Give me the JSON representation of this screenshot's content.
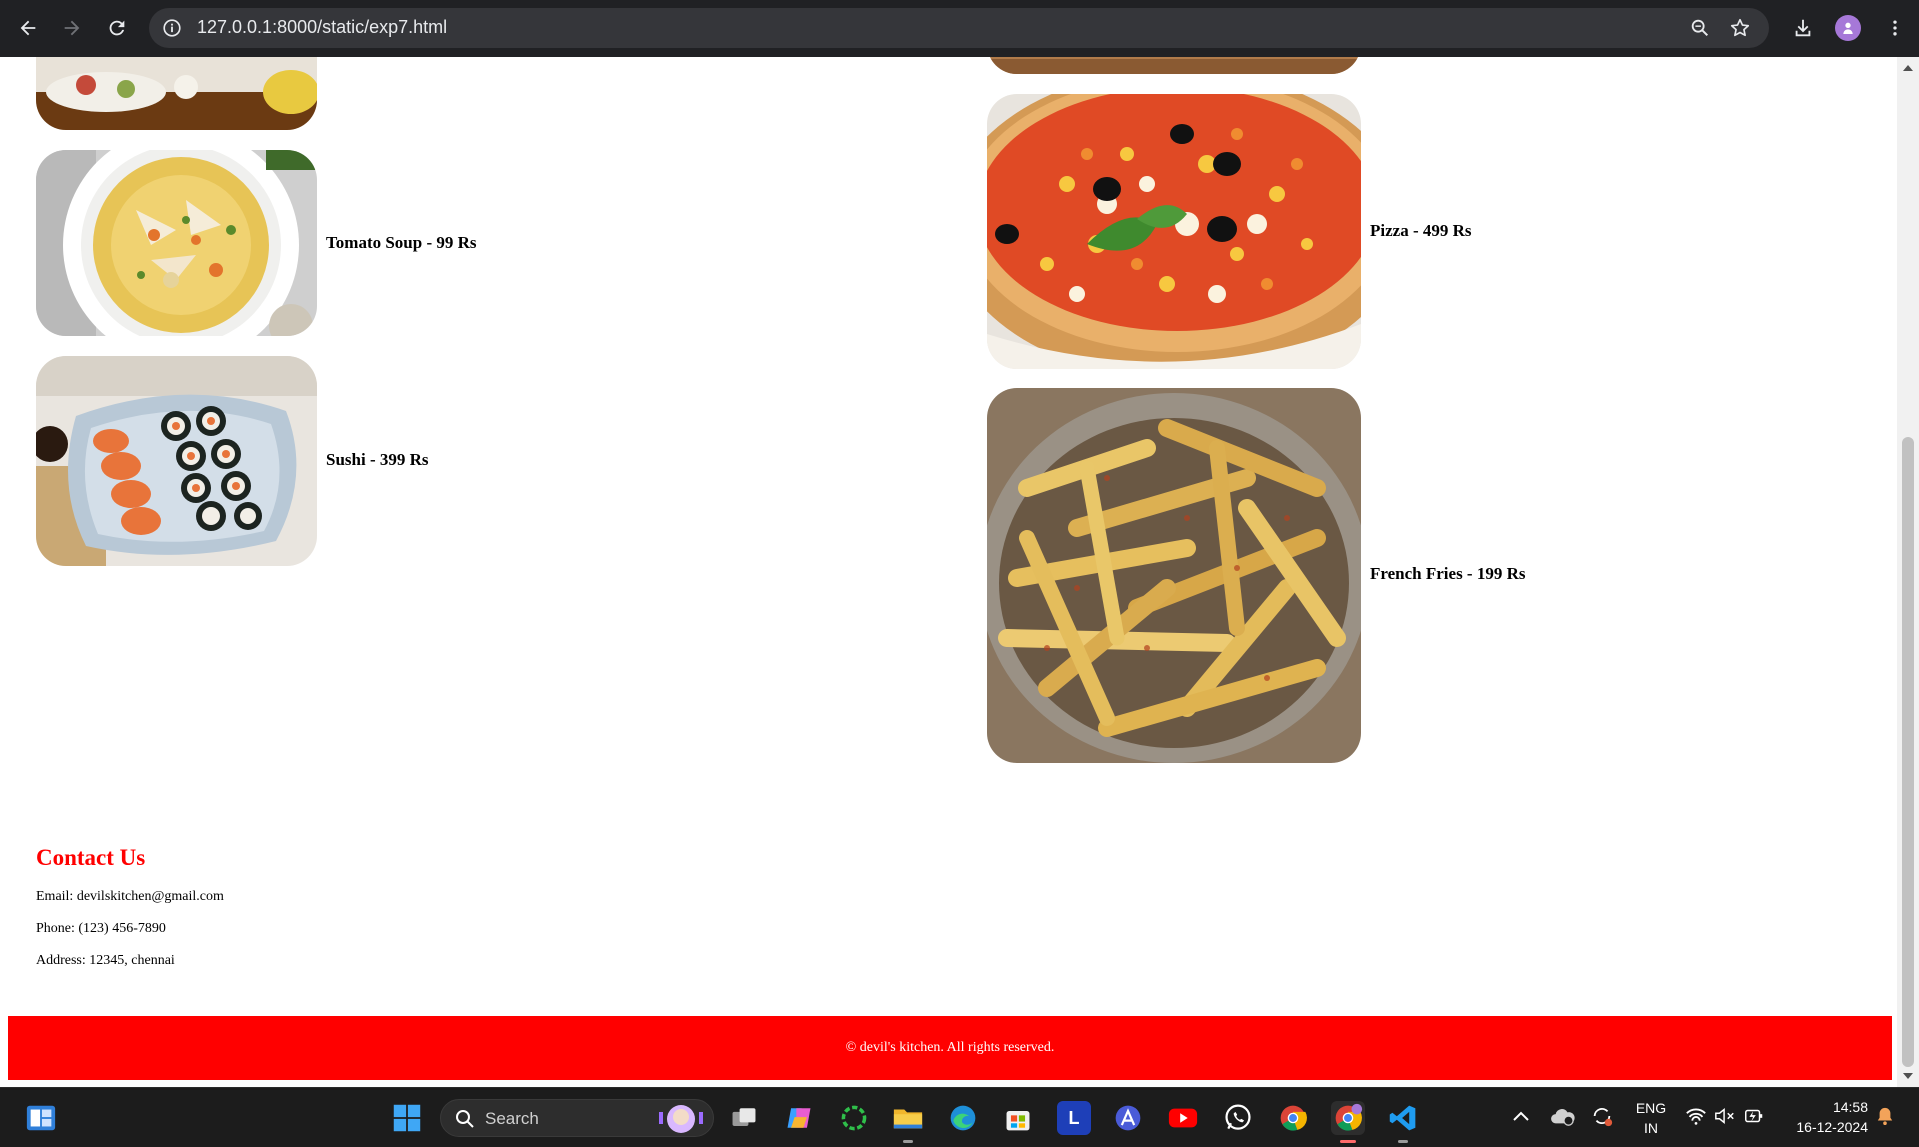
{
  "browser": {
    "url": "127.0.0.1:8000/static/exp7.html"
  },
  "menu": {
    "left": [
      {
        "label": "Tomato Soup - 99 Rs"
      },
      {
        "label": "Sushi - 399 Rs"
      }
    ],
    "right": [
      {
        "label": "Pizza - 499 Rs"
      },
      {
        "label": "French Fries - 199 Rs"
      }
    ]
  },
  "contact": {
    "title": "Contact Us",
    "email": "Email: devilskitchen@gmail.com",
    "phone": "Phone: (123) 456-7890",
    "address": "Address: 12345, chennai"
  },
  "footer": {
    "text": "© devil's kitchen. All rights reserved."
  },
  "taskbar": {
    "search_label": "Search",
    "language_top": "ENG",
    "language_bottom": "IN",
    "time": "14:58",
    "date": "16-12-2024"
  },
  "colors": {
    "accent": "#ff0000",
    "chrome_bg": "#202124",
    "taskbar_bg": "#1c1c1c"
  }
}
